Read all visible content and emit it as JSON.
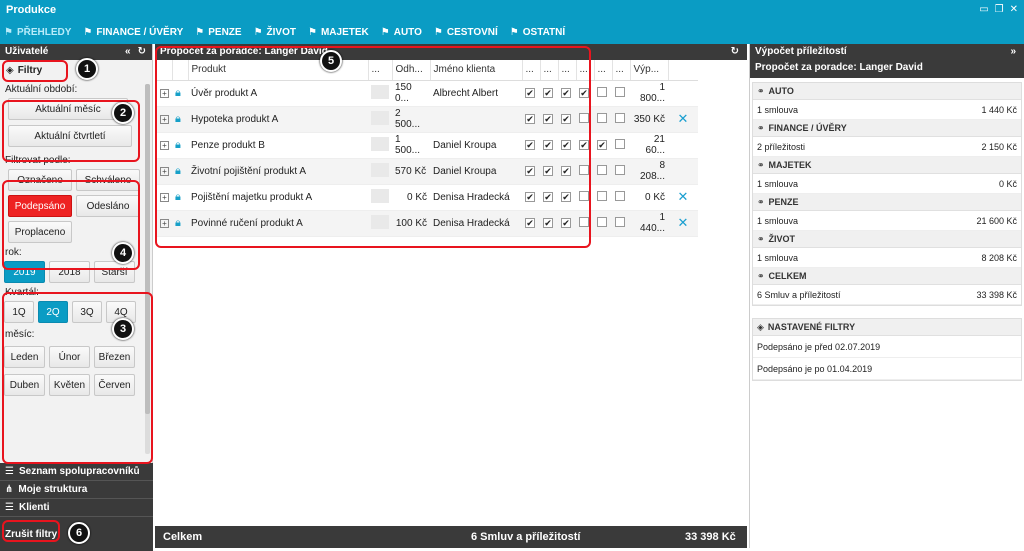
{
  "window": {
    "title": "Produkce"
  },
  "menu": [
    {
      "label": "PŘEHLEDY",
      "active": true
    },
    {
      "label": "FINANCE / ÚVĚRY"
    },
    {
      "label": "PENZE"
    },
    {
      "label": "ŽIVOT"
    },
    {
      "label": "MAJETEK"
    },
    {
      "label": "AUTO"
    },
    {
      "label": "CESTOVNÍ"
    },
    {
      "label": "OSTATNÍ"
    }
  ],
  "left": {
    "header": "Uživatelé",
    "filtry_tab": "Filtry",
    "aktualni_obdobi_label": "Aktuální období:",
    "btn_aktualni_mesic": "Aktuální měsíc",
    "btn_aktualni_ctvrtleti": "Aktuální čtvrtletí",
    "filtrovat_label": "Filtrovat podle:",
    "status": [
      "Označeno",
      "Schváleno",
      "Podepsáno",
      "Odesláno",
      "Proplaceno"
    ],
    "rok_label": "rok:",
    "years": [
      "2019",
      "2018",
      "Starší"
    ],
    "kvartal_label": "Kvartál:",
    "quarters": [
      "1Q",
      "2Q",
      "3Q",
      "4Q"
    ],
    "mesic_label": "měsíc:",
    "months": [
      "Leden",
      "Únor",
      "Březen",
      "Duben",
      "Květen",
      "Červen"
    ],
    "bottom_items": [
      "Seznam spolupracovníků",
      "Moje struktura",
      "Klienti"
    ],
    "zrusit_filtry": "Zrušit filtry"
  },
  "center": {
    "header": "Propočet za poradce: Langer David",
    "columns": [
      "Produkt",
      "...",
      "Odh...",
      "Jméno klienta",
      "...",
      "...",
      "...",
      "...",
      "...",
      "...",
      "Výp..."
    ],
    "rows": [
      {
        "produkt": "Úvěr produkt A",
        "odh": "150 0...",
        "klient": "Albrecht Albert",
        "vyp": "1 800...",
        "x": false
      },
      {
        "produkt": "Hypoteka produkt A",
        "odh": "2 500...",
        "klient": "",
        "vyp": "350 Kč",
        "x": true
      },
      {
        "produkt": "Penze produkt B",
        "odh": "1 500...",
        "klient": "Daniel Kroupa",
        "vyp": "21 60...",
        "x": false
      },
      {
        "produkt": "Životní pojištění produkt A",
        "odh": "570 Kč",
        "klient": "Daniel Kroupa",
        "vyp": "8 208...",
        "x": false
      },
      {
        "produkt": "Pojištění majetku produkt A",
        "odh": "0 Kč",
        "klient": "Denisa Hradecká",
        "vyp": "0 Kč",
        "x": true
      },
      {
        "produkt": "Povinné ručení produkt A",
        "odh": "100 Kč",
        "klient": "Denisa Hradecká",
        "vyp": "1 440...",
        "x": true
      }
    ],
    "footer_label": "Celkem",
    "footer_count": "6 Smluv a příležitostí",
    "footer_sum": "33 398 Kč"
  },
  "right": {
    "header": "Výpočet příležitostí",
    "subheader": "Propočet za poradce: Langer David",
    "sections": [
      {
        "title": "AUTO",
        "desc": "1 smlouva",
        "value": "1 440 Kč"
      },
      {
        "title": "FINANCE / ÚVĚRY",
        "desc": "2 příležitosti",
        "value": "2 150 Kč"
      },
      {
        "title": "MAJETEK",
        "desc": "1 smlouva",
        "value": "0 Kč"
      },
      {
        "title": "PENZE",
        "desc": "1 smlouva",
        "value": "21 600 Kč"
      },
      {
        "title": "ŽIVOT",
        "desc": "1 smlouva",
        "value": "8 208 Kč"
      },
      {
        "title": "CELKEM",
        "desc": "6 Smluv a příležitostí",
        "value": "33 398 Kč"
      }
    ],
    "saved_filters_title": "NASTAVENÉ FILTRY",
    "saved_filters": [
      "Podepsáno je před 02.07.2019",
      "Podepsáno je po 01.04.2019"
    ]
  },
  "callouts": [
    "1",
    "2",
    "3",
    "4",
    "5",
    "6"
  ],
  "colors": {
    "accent": "#0a9cc4",
    "highlight_red": "#e8141e",
    "dark_bar": "#3a3a3a"
  }
}
